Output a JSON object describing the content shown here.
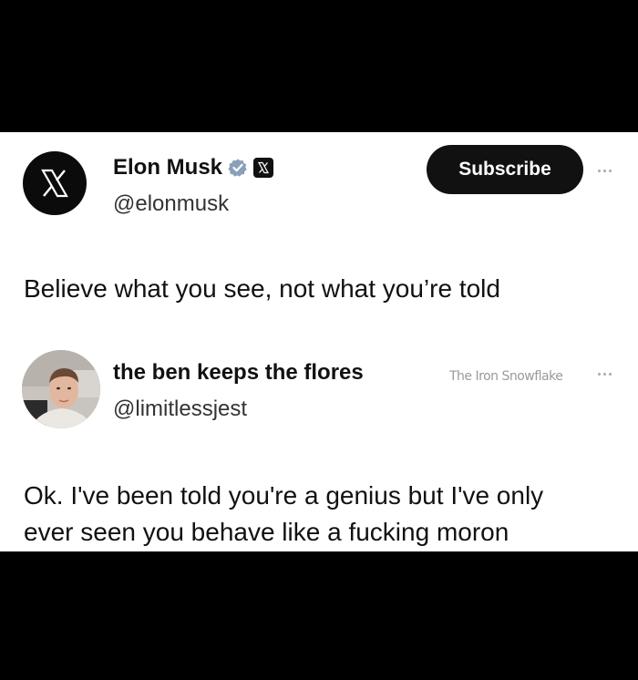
{
  "post": {
    "display_name": "Elon Musk",
    "handle": "@elonmusk",
    "subscribe_label": "Subscribe",
    "text": "Believe what you see, not what you’re told",
    "avatar_icon": "x-logo-icon",
    "verified_icon": "verified-badge-icon",
    "affiliation_icon": "x-affiliation-icon"
  },
  "reply": {
    "display_name": "the ben keeps the flores",
    "handle": "@limitlessjest",
    "text_line1": "Ok. I've been told you're a genius but I've only",
    "text_line2": "ever seen you behave like a fucking moron",
    "avatar": "profile-photo"
  },
  "watermark": "The Iron Snowflake",
  "colors": {
    "background": "#000000",
    "card": "#ffffff",
    "button": "#111111",
    "verified": "#8a9fb8"
  }
}
